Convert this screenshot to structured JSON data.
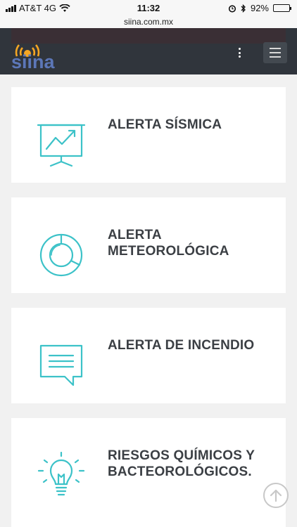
{
  "status_bar": {
    "carrier": "AT&T 4G",
    "time": "11:32",
    "battery": "92%",
    "battery_level": 0.92
  },
  "browser": {
    "url": "siina.com.mx"
  },
  "header": {
    "logo_text": "siina",
    "accent_color": "#f5a623",
    "logo_color": "#5c77b8"
  },
  "cards": [
    {
      "title": "ALERTA SÍSMICA",
      "icon": "presentation-chart-icon"
    },
    {
      "title": "ALERTA\nMETEOROLÓGICA",
      "icon": "donut-chart-icon"
    },
    {
      "title": "ALERTA DE INCENDIO",
      "icon": "speech-bubble-icon"
    },
    {
      "title": "RIESGOS QUÍMICOS Y\nBACTEOROLÓGICOS.",
      "icon": "lightbulb-icon"
    }
  ],
  "theme": {
    "icon_color": "#3cc2c8",
    "header_bg": "#30353c"
  }
}
